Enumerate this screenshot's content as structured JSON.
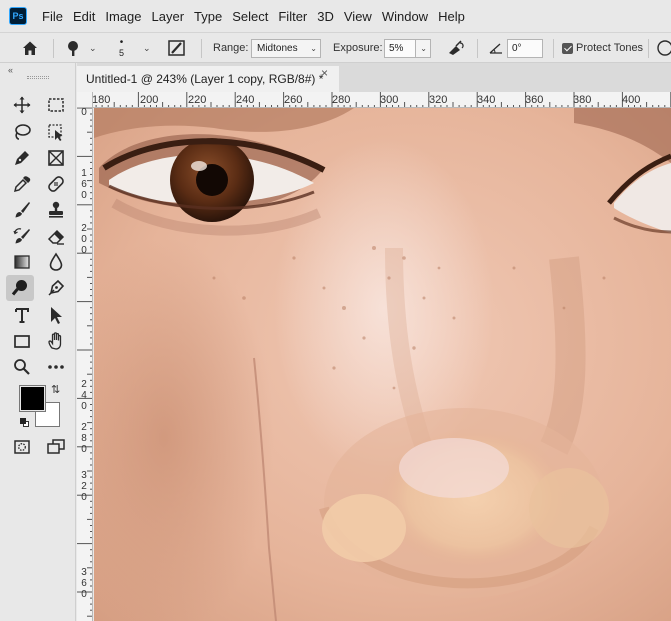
{
  "app": {
    "logo_text": "Ps"
  },
  "menu": [
    "File",
    "Edit",
    "Image",
    "Layer",
    "Type",
    "Select",
    "Filter",
    "3D",
    "View",
    "Window",
    "Help"
  ],
  "options": {
    "brush_size": "5",
    "range_label": "Range:",
    "range_value": "Midtones",
    "exposure_label": "Exposure:",
    "exposure_value": "5%",
    "angle_value": "0°",
    "protect_tones_label": "Protect Tones",
    "protect_tones_checked": true
  },
  "document_tab": {
    "title": "Untitled-1 @ 243% (Layer 1 copy, RGB/8#) *",
    "close": "×"
  },
  "ruler": {
    "horizontal": [
      "180",
      "200",
      "220",
      "240",
      "260",
      "280",
      "300",
      "320",
      "340",
      "360",
      "380",
      "400"
    ],
    "vertical": [
      [
        "0"
      ],
      [
        "1",
        "6",
        "0"
      ],
      [
        "2",
        "0",
        "0"
      ],
      [
        "2",
        "4",
        "0"
      ],
      [
        "2",
        "8",
        "0"
      ],
      [
        "3",
        "2",
        "0"
      ],
      [
        "3",
        "6",
        "0"
      ]
    ]
  },
  "colors": {
    "foreground": "#000000",
    "background": "#ffffff",
    "accent": "#31a8ff"
  },
  "tools": [
    "move-tool",
    "marquee-tool",
    "lasso-tool",
    "object-selection-tool",
    "pen-tool",
    "frame-tool",
    "eyedropper-tool",
    "healing-brush-tool",
    "brush-tool",
    "clone-stamp-tool",
    "history-brush-tool",
    "eraser-tool",
    "gradient-tool",
    "blur-tool",
    "burn-tool",
    "pen-tool-2",
    "type-tool",
    "path-selection-tool",
    "rectangle-tool",
    "hand-tool",
    "zoom-tool",
    "more-tools"
  ]
}
